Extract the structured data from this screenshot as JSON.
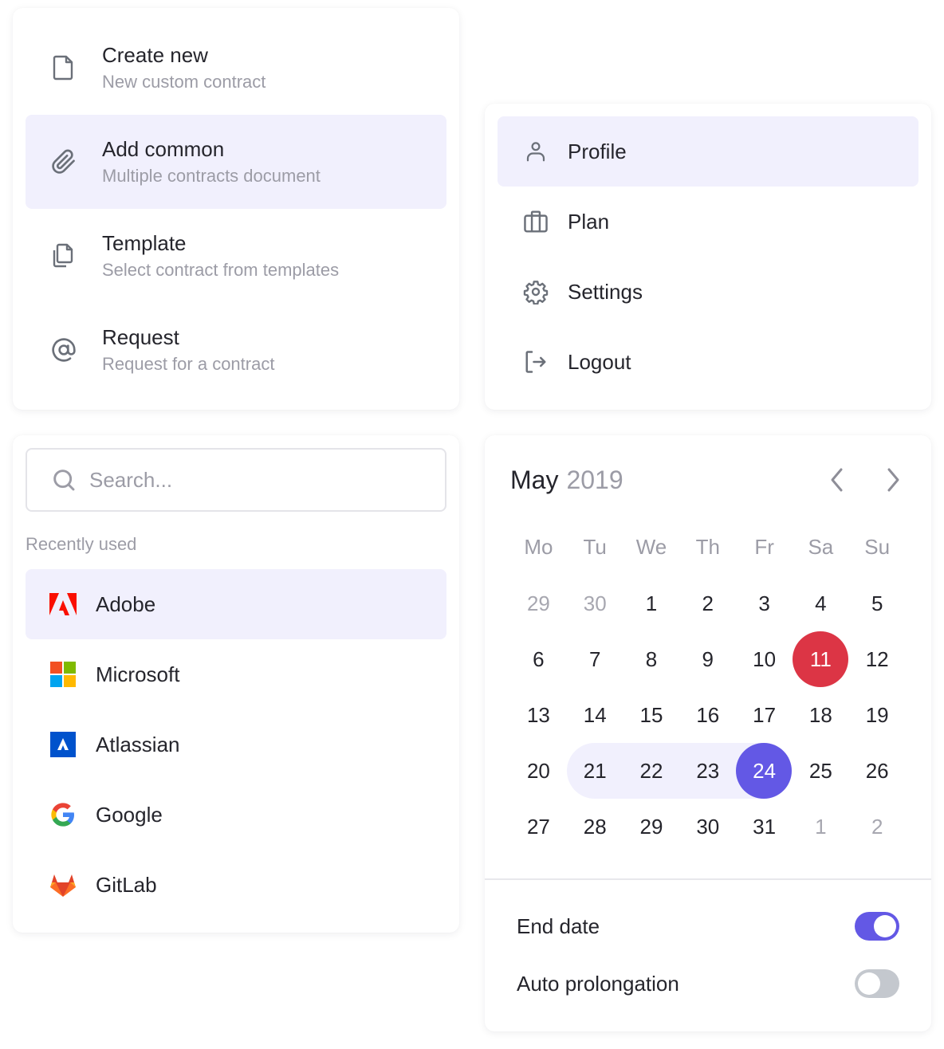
{
  "create_menu": {
    "items": [
      {
        "icon": "file-icon",
        "title": "Create new",
        "subtitle": "New custom contract",
        "active": false
      },
      {
        "icon": "paperclip-icon",
        "title": "Add common",
        "subtitle": "Multiple contracts document",
        "active": true
      },
      {
        "icon": "copy-icon",
        "title": "Template",
        "subtitle": "Select contract from templates",
        "active": false
      },
      {
        "icon": "at-icon",
        "title": "Request",
        "subtitle": "Request for a contract",
        "active": false
      }
    ]
  },
  "profile_menu": {
    "items": [
      {
        "icon": "user-icon",
        "label": "Profile",
        "active": true
      },
      {
        "icon": "briefcase-icon",
        "label": "Plan",
        "active": false
      },
      {
        "icon": "gear-icon",
        "label": "Settings",
        "active": false
      },
      {
        "icon": "logout-icon",
        "label": "Logout",
        "active": false
      }
    ]
  },
  "search": {
    "placeholder": "Search...",
    "value": "",
    "section_label": "Recently used",
    "apps": [
      {
        "icon": "adobe-logo-icon",
        "label": "Adobe",
        "active": true
      },
      {
        "icon": "microsoft-logo-icon",
        "label": "Microsoft",
        "active": false
      },
      {
        "icon": "atlassian-logo-icon",
        "label": "Atlassian",
        "active": false
      },
      {
        "icon": "google-logo-icon",
        "label": "Google",
        "active": false
      },
      {
        "icon": "gitlab-logo-icon",
        "label": "GitLab",
        "active": false
      }
    ]
  },
  "calendar": {
    "month": "May",
    "year": "2019",
    "prev_icon": "chevron-left-icon",
    "next_icon": "chevron-right-icon",
    "weekdays": [
      "Mo",
      "Tu",
      "We",
      "Th",
      "Fr",
      "Sa",
      "Su"
    ],
    "weeks": [
      [
        "29",
        "30",
        "1",
        "2",
        "3",
        "4",
        "5"
      ],
      [
        "6",
        "7",
        "8",
        "9",
        "10",
        "11",
        "12"
      ],
      [
        "13",
        "14",
        "15",
        "16",
        "17",
        "18",
        "19"
      ],
      [
        "20",
        "21",
        "22",
        "23",
        "24",
        "25",
        "26"
      ],
      [
        "27",
        "28",
        "29",
        "30",
        "31",
        "1",
        "2"
      ]
    ],
    "leading_outside_days": 2,
    "trailing_outside_days": 2,
    "today": "11",
    "selected": "24",
    "range": [
      "21",
      "24"
    ],
    "colors": {
      "today": "#dc3545",
      "selected": "#6358e5",
      "range": "#f1f0fd"
    }
  },
  "options": {
    "end_date": {
      "label": "End date",
      "on": true
    },
    "auto_prolongation": {
      "label": "Auto prolongation",
      "on": false
    }
  },
  "colors": {
    "accent": "#6358e5",
    "highlight": "#f1f0fd",
    "muted_text": "#9c9ca6"
  }
}
